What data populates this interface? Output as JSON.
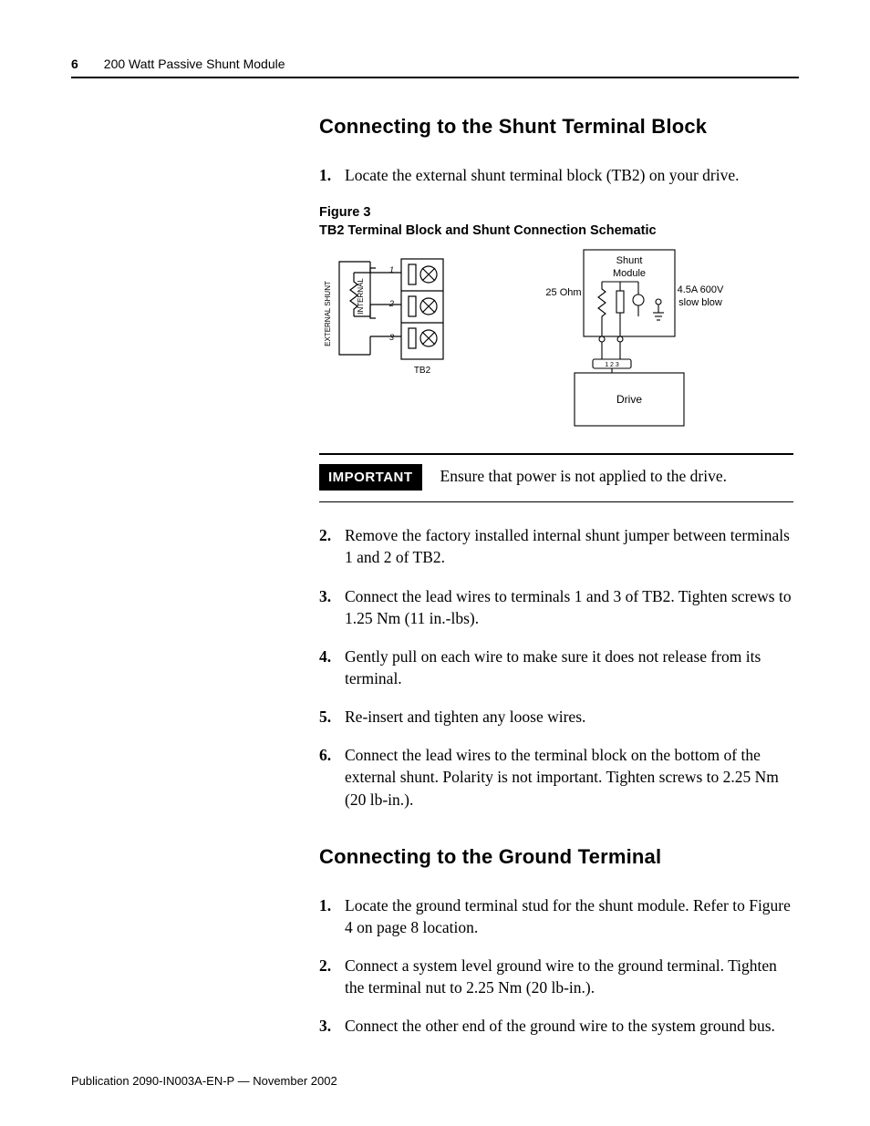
{
  "header": {
    "page_number": "6",
    "title": "200 Watt Passive Shunt Module"
  },
  "section1": {
    "heading": "Connecting to the Shunt Terminal Block",
    "step1": "Locate the external shunt terminal block (TB2) on your drive.",
    "figure_num": "Figure 3",
    "figure_title": "TB2 Terminal Block and Shunt Connection Schematic",
    "fig_labels": {
      "external_shunt": "EXTERNAL SHUNT",
      "internal": "INTERNAL",
      "t1": "1",
      "t2": "2",
      "t3": "3",
      "tb2": "TB2",
      "shunt_module": "Shunt\nModule",
      "res": "25 Ohm",
      "fuse1": "4.5A 600V",
      "fuse2": "slow blow",
      "conn": "1 2 3",
      "drive": "Drive"
    },
    "important_label": "IMPORTANT",
    "important_text": "Ensure that power is not applied to the drive.",
    "step2": "Remove the factory installed internal shunt jumper between terminals 1 and 2 of TB2.",
    "step3": "Connect the lead wires to terminals 1 and 3 of TB2. Tighten screws to 1.25 Nm (11 in.-lbs).",
    "step4": "Gently pull on each wire to make sure it does not release from its terminal.",
    "step5": "Re-insert and tighten any loose wires.",
    "step6": "Connect the lead wires to the terminal block on the bottom of the external shunt. Polarity is not important. Tighten screws to 2.25 Nm (20 lb-in.)."
  },
  "section2": {
    "heading": "Connecting to the Ground Terminal",
    "step1": "Locate the ground terminal stud for the shunt module. Refer to Figure 4 on page 8 location.",
    "step2": "Connect a system level ground wire to the ground terminal. Tighten the terminal nut to 2.25 Nm (20 lb-in.).",
    "step3": "Connect the other end of the ground wire to the system ground bus."
  },
  "footer": "Publication 2090-IN003A-EN-P — November 2002"
}
